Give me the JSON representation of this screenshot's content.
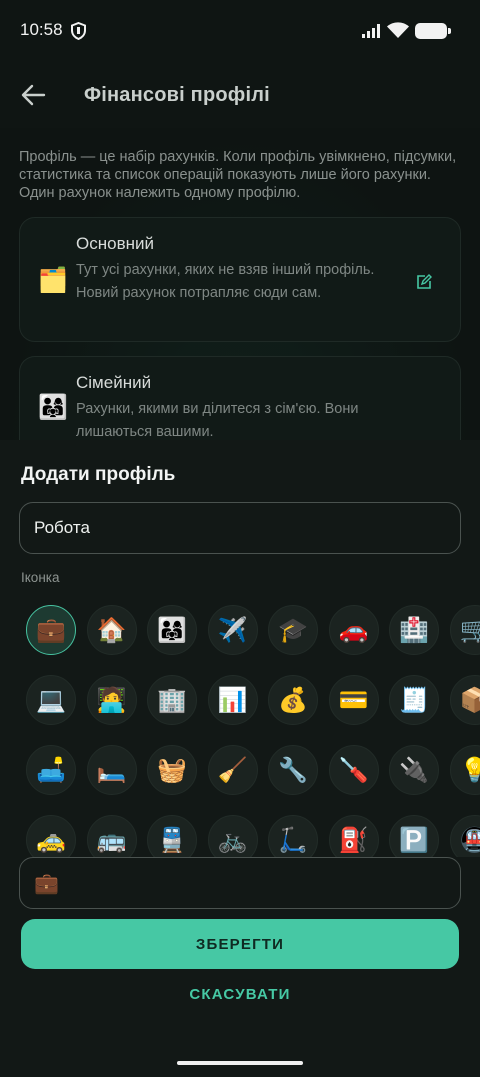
{
  "status_bar": {
    "time": "10:58"
  },
  "header": {
    "title": "Фінансові профілі"
  },
  "intro_text": "Профіль — це набір рахунків. Коли профіль увімкнено, підсумки, статистика та список операцій показують лише його рахунки. Один рахунок належить одному профілю.",
  "profiles": [
    {
      "emoji": "🗂️",
      "name": "Основний",
      "description": "Тут усі рахунки, яких не взяв інший профіль. Новий рахунок потрапляє сюди сам."
    },
    {
      "emoji": "👨‍👩‍👧",
      "name": "Сімейний",
      "description": "Рахунки, якими ви ділитеся з сім'єю. Вони лишаються вашими."
    }
  ],
  "sheet": {
    "title": "Додати профіль",
    "name_value": "Робота",
    "icon_label": "Іконка",
    "selected_icon": "💼",
    "save_label": "ЗБЕРЕГТИ",
    "cancel_label": "СКАСУВАТИ"
  },
  "icon_grid": [
    [
      "💼",
      "🏠",
      "👨‍👩‍👧",
      "✈️",
      "🎓",
      "🚗",
      "🏥",
      "🛒"
    ],
    [
      "💻",
      "🧑‍💻",
      "🏢",
      "📊",
      "💰",
      "💳",
      "🧾",
      "📦"
    ],
    [
      "🛋️",
      "🛏️",
      "🧺",
      "🧹",
      "🔧",
      "🪛",
      "🔌",
      "💡"
    ],
    [
      "🚕",
      "🚌",
      "🚆",
      "🚲",
      "🛴",
      "⛽",
      "🅿️",
      "🚇"
    ]
  ],
  "colors": {
    "accent": "#46c8a4",
    "background": "#0e1412",
    "sheet": "#121816"
  }
}
